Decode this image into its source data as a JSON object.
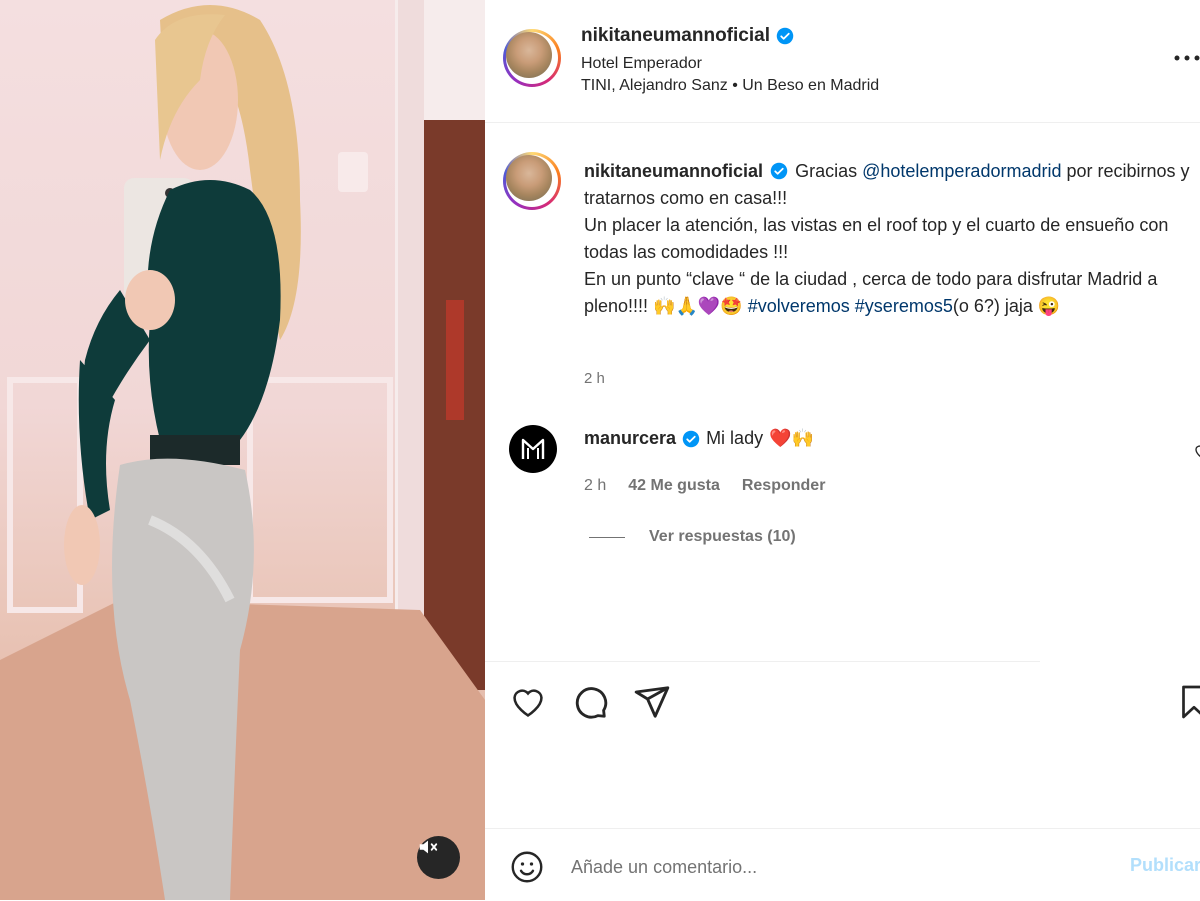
{
  "post": {
    "username": "nikitaneumannoficial",
    "location": "Hotel Emperador",
    "music": "TINI, Alejandro Sanz • Un Beso en Madrid",
    "caption": {
      "part1": "Gracias",
      "mention": "@hotelemperadormadrid",
      "part2": "por recibirnos y tratarnos como en casa!!!",
      "line2": "Un placer la atención, las vistas en el roof top y el cuarto de ensueño con todas las comodidades !!!",
      "line3": "En un punto “clave “ de la ciudad , cerca de todo para disfrutar Madrid a pleno!!!!",
      "emojis1": "🙌🙏💜🤩",
      "hashtag1": "#volveremos",
      "hashtag2": "#yseremos5",
      "tail": "(o 6?) jaja",
      "emoji_end": "😜"
    },
    "time": "2 h"
  },
  "comment": {
    "username": "manurcera",
    "text": "Mi lady",
    "emojis": "❤️🙌",
    "time": "2 h",
    "likes": "42 Me gusta",
    "reply": "Responder",
    "view_replies": "Ver respuestas (10)"
  },
  "composer": {
    "placeholder": "Añade un comentario...",
    "publish": "Publicar"
  },
  "icons": {
    "verified": "verified-badge-icon",
    "more": "more-options-icon",
    "like": "heart-icon",
    "comment": "comment-bubble-icon",
    "share": "send-paper-plane-icon",
    "save": "bookmark-icon",
    "emoji": "smiley-icon",
    "mute": "speaker-muted-icon",
    "avatar_logo": "mu-monogram-icon"
  },
  "colors": {
    "verified_blue": "#0095f6",
    "link_blue": "#00376b",
    "publish_disabled": "#b2dffc",
    "secondary_text": "#737373",
    "heart_red": "#ed4956"
  }
}
